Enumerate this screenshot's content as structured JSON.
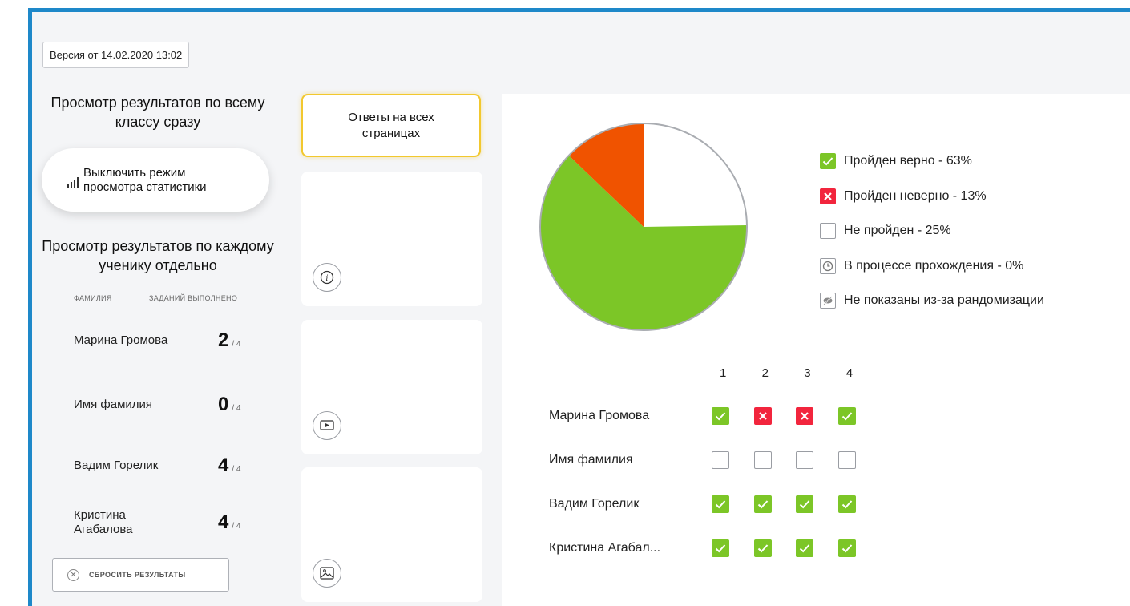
{
  "version": "Версия от 14.02.2020 13:02",
  "left": {
    "heading_class": "Просмотр результатов по всему классу сразу",
    "stats_toggle": "Выключить режим просмотра статистики",
    "heading_students": "Просмотр результатов по каждому ученику отдельно",
    "col_surname": "фамилия",
    "col_done": "заданий выполнено",
    "students": [
      {
        "name": "Марина Громова",
        "score": "2",
        "total": "/ 4"
      },
      {
        "name": "Имя фамилия",
        "score": "0",
        "total": "/ 4"
      },
      {
        "name": "Вадим Горелик",
        "score": "4",
        "total": "/ 4"
      },
      {
        "name": "Кристина Агабалова",
        "score": "4",
        "total": "/ 4"
      }
    ],
    "reset": "сбросить результаты"
  },
  "middle": {
    "answers_all_pages": "Ответы на всех страницах",
    "page_icons": [
      "info-icon",
      "video-icon",
      "image-icon"
    ]
  },
  "results": {
    "pie": {
      "correct": 63,
      "incorrect": 13,
      "not_passed": 25,
      "in_progress": 0
    },
    "colors": {
      "correct": "#7cc627",
      "incorrect": "#f05300",
      "not_passed": "#ffffff",
      "fail_mark": "#f2253d"
    },
    "legend": [
      {
        "label": "Пройден верно - 63%",
        "kind": "ok"
      },
      {
        "label": "Пройден неверно - 13%",
        "kind": "fail"
      },
      {
        "label": "Не пройден - 25%",
        "kind": "empty"
      },
      {
        "label": "В процессе прохождения - 0%",
        "kind": "clock"
      },
      {
        "label": "Не показаны из-за рандомизации",
        "kind": "hidden"
      }
    ],
    "task_numbers": [
      "1",
      "2",
      "3",
      "4"
    ],
    "matrix": [
      {
        "name": "Марина Громова",
        "cells": [
          "ok",
          "fail",
          "fail",
          "ok"
        ]
      },
      {
        "name": "Имя фамилия",
        "cells": [
          "empty",
          "empty",
          "empty",
          "empty"
        ]
      },
      {
        "name": "Вадим Горелик",
        "cells": [
          "ok",
          "ok",
          "ok",
          "ok"
        ]
      },
      {
        "name": "Кристина Агабал...",
        "cells": [
          "ok",
          "ok",
          "ok",
          "ok"
        ]
      }
    ]
  }
}
